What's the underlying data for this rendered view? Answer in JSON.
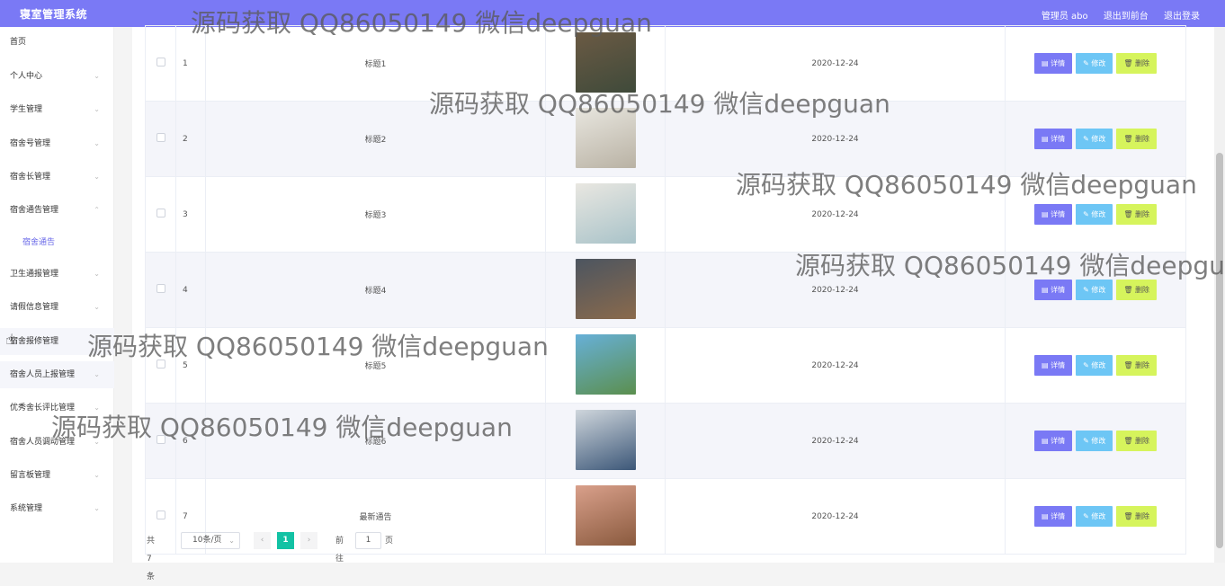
{
  "header": {
    "title": "寝室管理系统",
    "user": "管理员 abo",
    "front_link": "退出到前台",
    "logout_link": "退出登录"
  },
  "sidebar": {
    "items": [
      {
        "label": "首页"
      },
      {
        "label": "个人中心"
      },
      {
        "label": "学生管理"
      },
      {
        "label": "宿舍号管理"
      },
      {
        "label": "宿舍长管理"
      },
      {
        "label": "宿舍通告管理"
      },
      {
        "label": "卫生通报管理"
      },
      {
        "label": "请假信息管理"
      },
      {
        "label": "宿舍报修管理"
      },
      {
        "label": "宿舍人员上报管理"
      },
      {
        "label": "优秀舍长评比管理"
      },
      {
        "label": "宿舍人员调动管理"
      },
      {
        "label": "留言板管理"
      },
      {
        "label": "系统管理"
      }
    ],
    "active_sub": "宿舍通告"
  },
  "table": {
    "rows": [
      {
        "index": "1",
        "title": "标题1",
        "date": "2020-12-24",
        "image_colors": [
          "#6b5a44",
          "#3f4a3a"
        ]
      },
      {
        "index": "2",
        "title": "标题2",
        "date": "2020-12-24",
        "image_colors": [
          "#e8e6df",
          "#b9b2a4"
        ]
      },
      {
        "index": "3",
        "title": "标题3",
        "date": "2020-12-24",
        "image_colors": [
          "#e9e7e1",
          "#a9c3c9"
        ]
      },
      {
        "index": "4",
        "title": "标题4",
        "date": "2020-12-24",
        "image_colors": [
          "#4c5560",
          "#8a6a4c"
        ]
      },
      {
        "index": "5",
        "title": "标题5",
        "date": "2020-12-24",
        "image_colors": [
          "#67b0d8",
          "#5b8f4e"
        ]
      },
      {
        "index": "6",
        "title": "标题6",
        "date": "2020-12-24",
        "image_colors": [
          "#cfd6dc",
          "#3c5778"
        ]
      },
      {
        "index": "7",
        "title": "最新通告",
        "date": "2020-12-24",
        "image_colors": [
          "#d9a08b",
          "#8a5a3e"
        ]
      }
    ],
    "actions": {
      "detail": "详情",
      "edit": "修改",
      "delete": "删除"
    }
  },
  "pagination": {
    "total": "共 7 条",
    "page_size": "10条/页",
    "current_page": "1",
    "goto_label": "前往",
    "goto_value": "1",
    "page_unit": "页"
  },
  "watermark": "源码获取 QQ86050149 微信deepguan",
  "icons": {
    "detail": "document-icon",
    "edit": "pencil-icon",
    "delete": "trash-icon"
  }
}
